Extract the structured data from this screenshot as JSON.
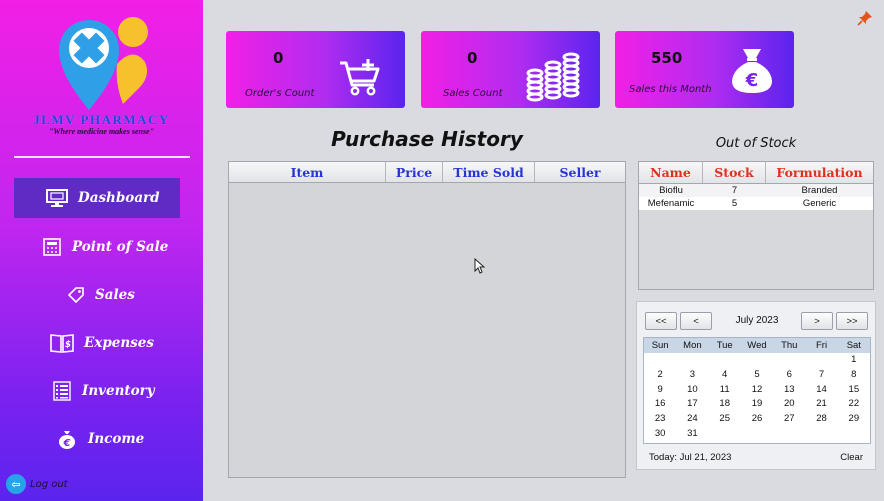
{
  "sidebar": {
    "brand": "JLMV PHARMACY",
    "tagline": "\"Where medicine makes sense\"",
    "items": [
      {
        "label": "Dashboard",
        "icon": "monitor-icon",
        "active": true
      },
      {
        "label": "Point of Sale",
        "icon": "register-icon",
        "active": false
      },
      {
        "label": "Sales",
        "icon": "price-tag-icon",
        "active": false
      },
      {
        "label": "Expenses",
        "icon": "ledger-book-icon",
        "active": false
      },
      {
        "label": "Inventory",
        "icon": "list-icon",
        "active": false
      },
      {
        "label": "Income",
        "icon": "euro-coin-icon",
        "active": false
      }
    ],
    "logout_label": "Log out"
  },
  "cards": [
    {
      "value": "0",
      "label": "Order's Count",
      "icon": "cart-add-icon"
    },
    {
      "value": "0",
      "label": "Sales Count",
      "icon": "coin-stacks-icon"
    },
    {
      "value": "550",
      "label": "Sales this Month",
      "icon": "money-bag-icon"
    }
  ],
  "purchase_history": {
    "title": "Purchase History",
    "columns": [
      "Item",
      "Price",
      "Time Sold",
      "Seller"
    ],
    "rows": []
  },
  "out_of_stock": {
    "title": "Out of Stock",
    "columns": [
      "Name",
      "Stock",
      "Formulation"
    ],
    "rows": [
      [
        "Bioflu",
        "7",
        "Branded"
      ],
      [
        "Mefenamic",
        "5",
        "Generic"
      ]
    ]
  },
  "calendar": {
    "buttons": {
      "prev_year": "<<",
      "prev_month": "<",
      "next_month": ">",
      "next_year": ">>"
    },
    "month_label": "July  2023",
    "weekdays": [
      "Sun",
      "Mon",
      "Tue",
      "Wed",
      "Thu",
      "Fri",
      "Sat"
    ],
    "weeks": [
      [
        "",
        "",
        "",
        "",
        "",
        "",
        "1"
      ],
      [
        "2",
        "3",
        "4",
        "5",
        "6",
        "7",
        "8"
      ],
      [
        "9",
        "10",
        "11",
        "12",
        "13",
        "14",
        "15"
      ],
      [
        "16",
        "17",
        "18",
        "19",
        "20",
        "21",
        "22"
      ],
      [
        "23",
        "24",
        "25",
        "26",
        "27",
        "28",
        "29"
      ],
      [
        "30",
        "31",
        "",
        "",
        "",
        "",
        ""
      ]
    ],
    "today_label": "Today:  Jul 21, 2023",
    "clear_label": "Clear"
  },
  "colors": {
    "sidebar_top": "#f21fe6",
    "sidebar_bottom": "#5a24ee",
    "active_nav": "#5f2bc4",
    "history_header_text": "#2834d6",
    "stock_header_text": "#e0311f"
  }
}
